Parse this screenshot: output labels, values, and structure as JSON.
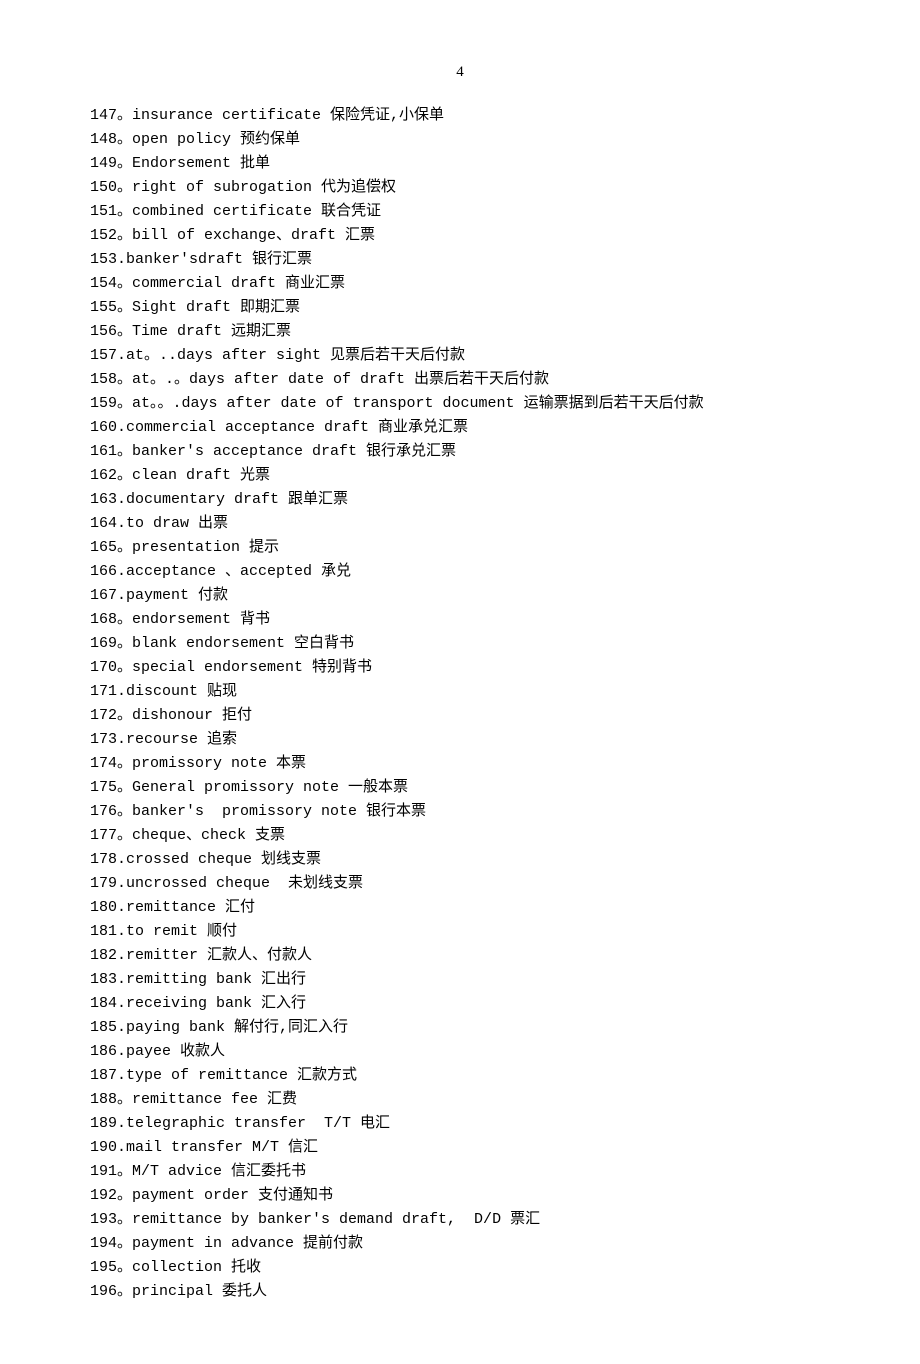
{
  "page_number": "4",
  "entries": [
    "147。insurance certificate 保险凭证,小保单",
    "148。open policy 预约保单",
    "149。Endorsement 批单",
    "150。right of subrogation 代为追偿权",
    "151。combined certificate 联合凭证",
    "152。bill of exchange、draft 汇票",
    "153.banker'sdraft 银行汇票",
    "154。commercial draft 商业汇票",
    "155。Sight draft 即期汇票",
    "156。Time draft 远期汇票",
    "157.at。..days after sight 见票后若干天后付款",
    "158。at。.。days after date of draft 出票后若干天后付款",
    "159。at。。.days after date of transport document 运输票据到后若干天后付款",
    "160.commercial acceptance draft 商业承兑汇票",
    "161。banker's acceptance draft 银行承兑汇票",
    "162。clean draft 光票",
    "163.documentary draft 跟单汇票",
    "164.to draw 出票",
    "165。presentation 提示",
    "166.acceptance 、accepted 承兑",
    "167.payment 付款",
    "168。endorsement 背书",
    "169。blank endorsement 空白背书",
    "170。special endorsement 特别背书",
    "171.discount 贴现",
    "172。dishonour 拒付",
    "173.recourse 追索",
    "174。promissory note 本票",
    "175。General promissory note 一般本票",
    "176。banker's  promissory note 银行本票",
    "177。cheque、check 支票",
    "178.crossed cheque 划线支票",
    "179.uncrossed cheque  未划线支票",
    "180.remittance 汇付",
    "181.to remit 顺付",
    "182.remitter 汇款人、付款人",
    "183.remitting bank 汇出行",
    "184.receiving bank 汇入行",
    "185.paying bank 解付行,同汇入行",
    "186.payee 收款人",
    "187.type of remittance 汇款方式",
    "188。remittance fee 汇费",
    "189.telegraphic transfer  T/T 电汇",
    "190.mail transfer M/T 信汇",
    "191。M/T advice 信汇委托书",
    "192。payment order 支付通知书",
    "193。remittance by banker's demand draft,  D/D 票汇",
    "194。payment in advance 提前付款",
    "195。collection 托收",
    "196。principal 委托人"
  ]
}
